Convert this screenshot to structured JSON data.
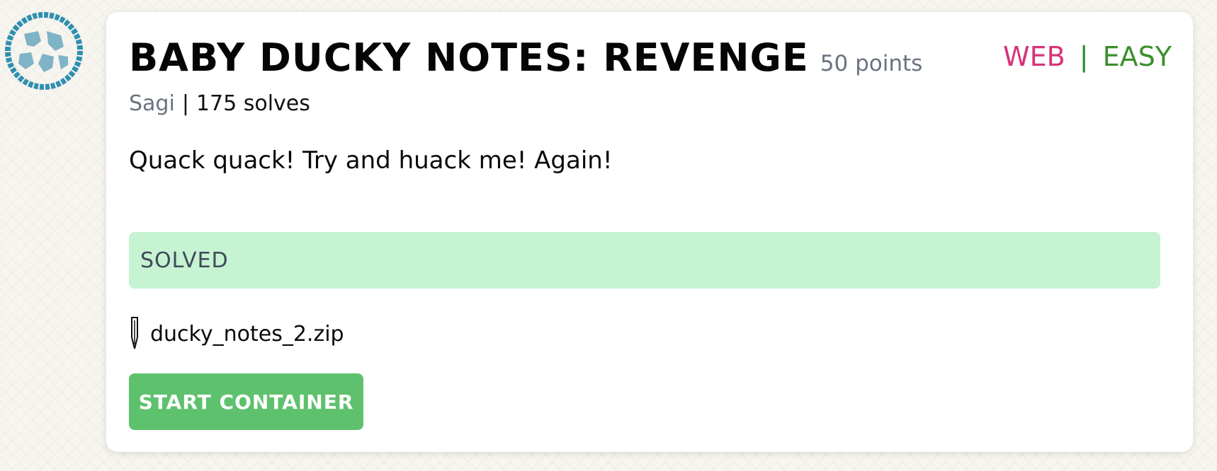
{
  "logo": {
    "icon": "globe-logo-icon",
    "color": "#2f8fb0"
  },
  "challenge": {
    "title": "BABY DUCKY NOTES: REVENGE",
    "points": "50 points",
    "category": "WEB",
    "separator": "|",
    "difficulty": "EASY",
    "author": "Sagi",
    "solves": "175 solves",
    "description": "Quack quack! Try and huack me! Again!",
    "status": "SOLVED",
    "file": {
      "icon": "pen-nib-icon",
      "name": "ducky_notes_2.zip"
    },
    "start_button_label": "START CONTAINER"
  },
  "colors": {
    "category": "#d6337a",
    "difficulty": "#3b8f2b",
    "solved_background": "#c6f3d2",
    "button": "#5ec16d"
  }
}
